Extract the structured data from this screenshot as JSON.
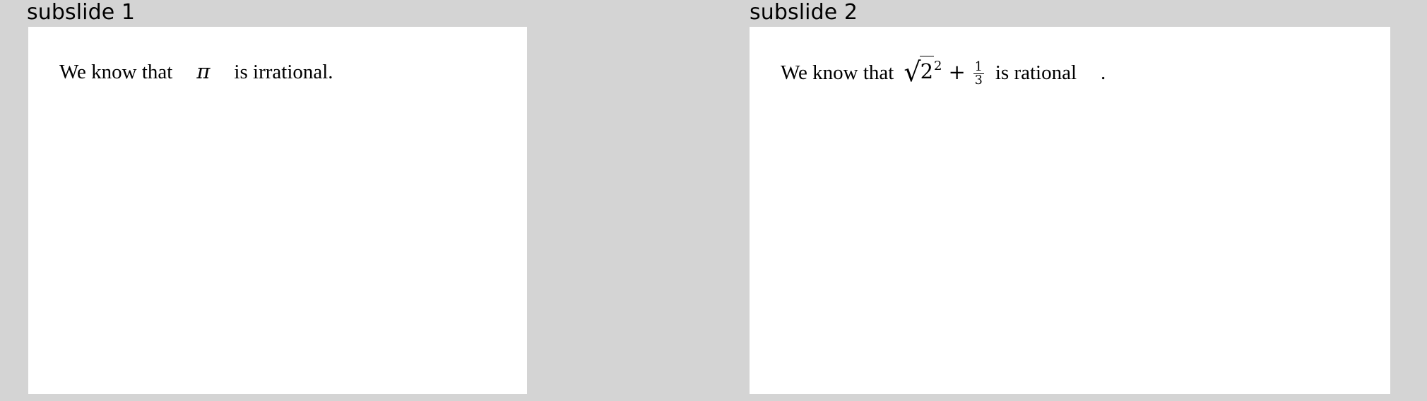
{
  "page": {
    "background_color": "#d4d4d4",
    "slide_color": "#ffffff",
    "text_color": "#000000"
  },
  "subslides": [
    {
      "label": "subslide 1",
      "text": {
        "lead": "We know that",
        "subject_symbol": "π",
        "trailing": "is irrational."
      }
    },
    {
      "label": "subslide 2",
      "text": {
        "lead": "We know that",
        "formula": {
          "sqrt_radicand": "2",
          "sqrt_exponent": "2",
          "operator": "+",
          "fraction_numerator": "1",
          "fraction_denominator": "3"
        },
        "trailing": "is rational",
        "period": "."
      }
    }
  ]
}
